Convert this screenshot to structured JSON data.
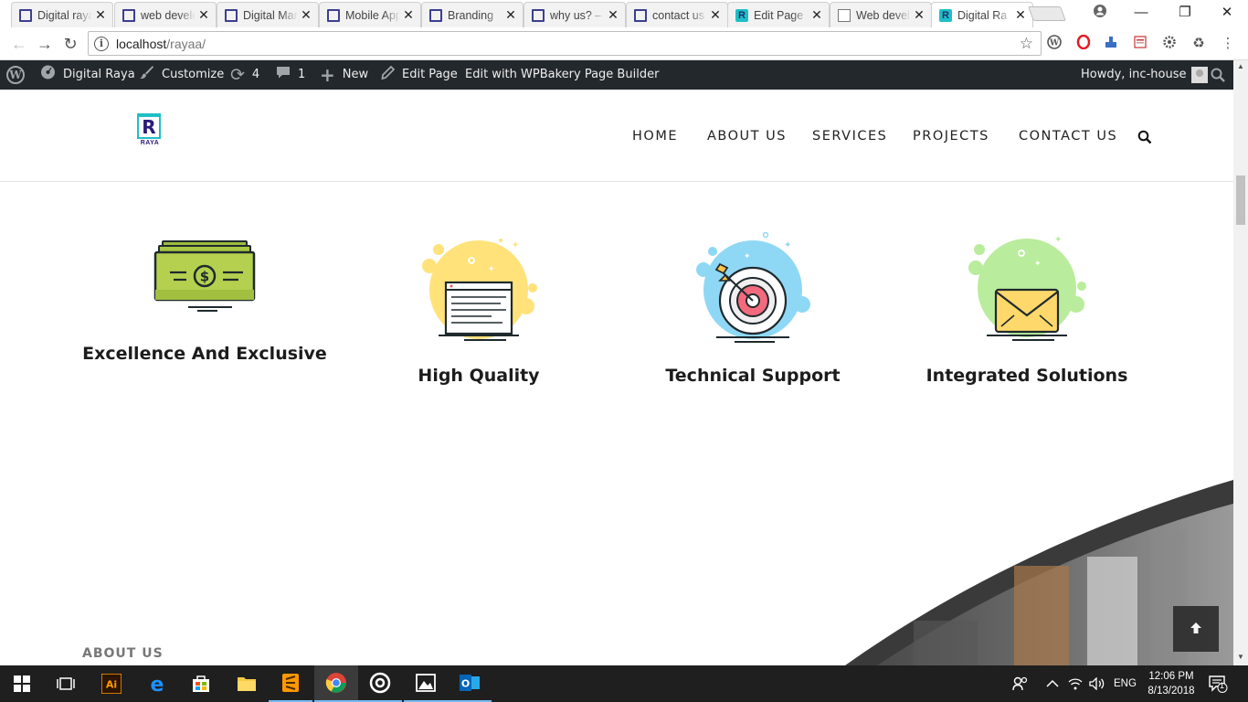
{
  "browser": {
    "tabs": [
      {
        "label": "Digital raya",
        "favicon": "doc"
      },
      {
        "label": "web develo",
        "favicon": "doc"
      },
      {
        "label": "Digital Mar",
        "favicon": "doc"
      },
      {
        "label": "Mobile App",
        "favicon": "doc"
      },
      {
        "label": "Branding",
        "favicon": "doc"
      },
      {
        "label": "why us? –",
        "favicon": "doc"
      },
      {
        "label": "contact us",
        "favicon": "doc"
      },
      {
        "label": "Edit Page",
        "favicon": "raya"
      },
      {
        "label": "Web devel",
        "favicon": "page"
      },
      {
        "label": "Digital Ra",
        "favicon": "raya",
        "active": true
      }
    ],
    "close_glyph": "✕",
    "url_host": "localhost",
    "url_path": "/rayaa/"
  },
  "adminbar": {
    "site_name": "Digital Raya",
    "customize": "Customize",
    "updates_count": "4",
    "comments_count": "1",
    "new": "New",
    "edit_page": "Edit Page",
    "wpbakery": "Edit with WPBakery Page Builder",
    "howdy": "Howdy, inc-house"
  },
  "site": {
    "logo_letter": "R",
    "logo_word": "RAYA",
    "nav": [
      "HOME",
      "ABOUT US",
      "SERVICES",
      "PROJECTS",
      "CONTACT US"
    ]
  },
  "features": [
    {
      "title": "Excellence And Exclusive",
      "icon": "money-icon"
    },
    {
      "title": "High Quality",
      "icon": "browser-window-icon"
    },
    {
      "title": "Technical Support",
      "icon": "target-icon"
    },
    {
      "title": "Integrated Solutions",
      "icon": "envelope-icon"
    }
  ],
  "section": {
    "about_label": "ABOUT US"
  },
  "colors": {
    "adminbar": "#23282d",
    "accent_teal": "#1fbfc7",
    "logo_navy": "#2a1b7a",
    "money_green": "#b5d04e",
    "yellow_blob": "#ffe27a",
    "blue_blob": "#8fd8f5",
    "green_blob": "#b9ec9c"
  },
  "taskbar": {
    "time": "12:06 PM",
    "date": "8/13/2018",
    "lang": "ENG",
    "notifications": "1"
  }
}
